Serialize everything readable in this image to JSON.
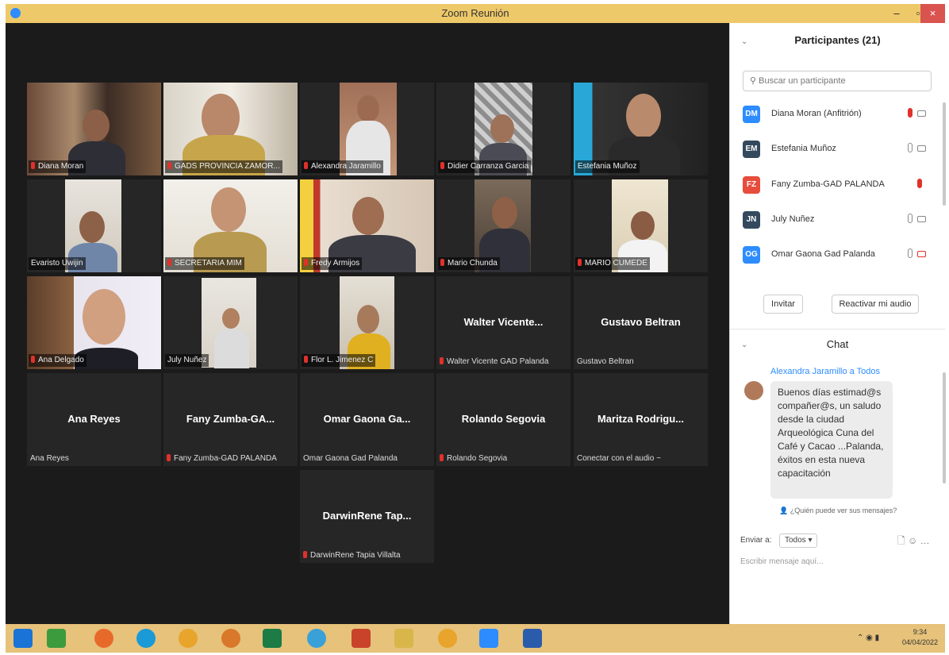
{
  "window": {
    "title": "Zoom Reunión",
    "minimize": "–",
    "maximize": "▫",
    "close": "×"
  },
  "tiles_video": [
    {
      "name": "Diana Moran",
      "muted": true
    },
    {
      "name": "GADS PROVINCIA ZAMOR...",
      "muted": true
    },
    {
      "name": "Alexandra Jaramillo",
      "muted": true
    },
    {
      "name": "Didier Carranza Garcia",
      "muted": true
    },
    {
      "name": "Estefania Muñoz",
      "muted": false
    },
    {
      "name": "Evaristo Uwijin",
      "muted": false
    },
    {
      "name": "SECRETARIA MIM",
      "muted": true
    },
    {
      "name": "Fredy Armijos",
      "muted": true
    },
    {
      "name": "Mario Chunda",
      "muted": true
    },
    {
      "name": "MARIO CUMEDE",
      "muted": true
    },
    {
      "name": "Ana Delgado",
      "muted": true
    },
    {
      "name": "July Nuñez",
      "muted": false
    },
    {
      "name": "Flor L. Jimenez C",
      "muted": true
    }
  ],
  "tiles_audio": [
    {
      "big": "Walter Vicente...",
      "label": "Walter Vicente GAD Palanda",
      "muted": true
    },
    {
      "big": "Gustavo Beltran",
      "label": "Gustavo Beltran",
      "muted": false
    },
    {
      "big": "Ana Reyes",
      "label": "Ana Reyes",
      "muted": false
    },
    {
      "big": "Fany Zumba-GA...",
      "label": "Fany Zumba-GAD PALANDA",
      "muted": true
    },
    {
      "big": "Omar Gaona Ga...",
      "label": "Omar Gaona Gad Palanda",
      "muted": false
    },
    {
      "big": "Rolando Segovia",
      "label": "Rolando Segovia",
      "muted": true
    },
    {
      "big": "Maritza Rodrigu...",
      "label": "Conectar con el audio ~",
      "muted": false
    },
    {
      "big": "DarwinRene Tap...",
      "label": "DarwinRene Tapia Villalta",
      "muted": true
    }
  ],
  "participants_panel": {
    "title": "Participantes (21)",
    "search_placeholder": "Buscar un participante",
    "items": [
      {
        "initials": "DM",
        "name": "Diana Moran (Anfitrión)",
        "color": "#2d8cff"
      },
      {
        "initials": "EM",
        "name": "Estefania Muñoz",
        "color": "#34495e"
      },
      {
        "initials": "FZ",
        "name": "Fany Zumba-GAD PALANDA",
        "color": "#e74c3c"
      },
      {
        "initials": "JN",
        "name": "July Nuñez",
        "color": "#34495e"
      },
      {
        "initials": "OG",
        "name": "Omar Gaona Gad Palanda",
        "color": "#2d8cff"
      }
    ],
    "invite": "Invitar",
    "reactivate": "Reactivar mi audio"
  },
  "chat": {
    "title": "Chat",
    "sender": "Alexandra Jaramillo a Todos",
    "message": "Buenos días estimad@s compañer@s, un saludo desde la ciudad Arqueológica Cuna del Café y Cacao ...Palanda, éxitos en esta nueva capacitación",
    "who_sees": "¿Quién puede ver sus mensajes?",
    "send_to_label": "Enviar a:",
    "send_to_value": "Todos ▾",
    "input_placeholder": "Escribir mensaje aquí..."
  },
  "taskbar": {
    "icons": [
      "windows-icon",
      "store-icon",
      "firefox-icon",
      "edge-icon",
      "chrome-icon",
      "chrome-icon",
      "excel-icon",
      "ie-icon",
      "powerpoint-icon",
      "explorer-icon",
      "chrome-icon",
      "zoom-icon",
      "word-icon"
    ],
    "time": "9:34",
    "date": "04/04/2022"
  },
  "colors": {
    "titlebar": "#eec96a",
    "taskbar": "#e6c27a",
    "video_bg": "#1b1b1b",
    "tile_bg": "#262626",
    "active_border": "#c9e45c",
    "accent": "#2d8cff",
    "muted": "#e0312b"
  }
}
